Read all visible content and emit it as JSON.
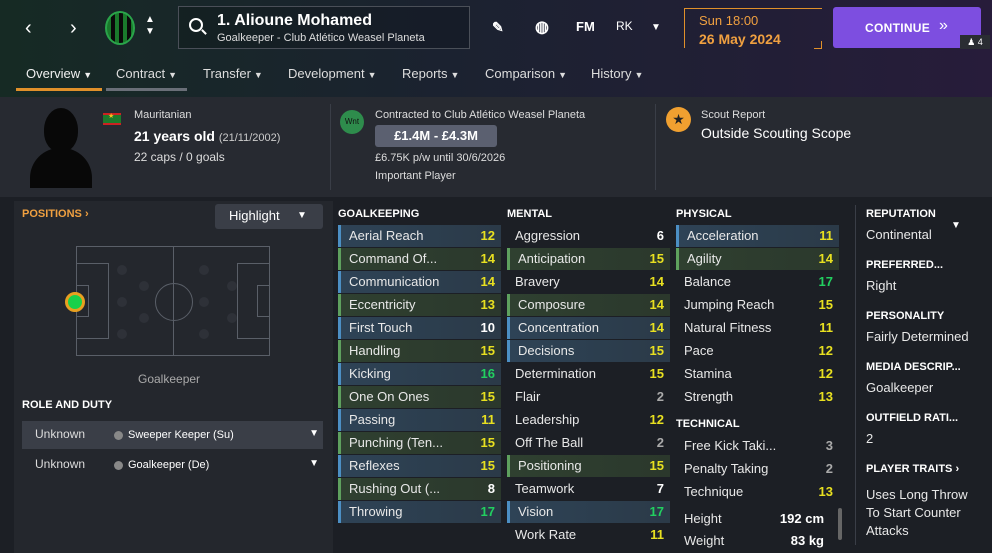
{
  "header": {
    "player_name": "1. Alioune Mohamed",
    "player_sub": "Goalkeeper - Club Atlético Weasel Planeta",
    "fm_label": "FM",
    "initials": "RK",
    "day_time": "Sun 18:00",
    "date": "26 May 2024",
    "continue_label": "CONTINUE",
    "manager_count": "4"
  },
  "tabs": [
    {
      "label": "Overview"
    },
    {
      "label": "Contract"
    },
    {
      "label": "Transfer"
    },
    {
      "label": "Development"
    },
    {
      "label": "Reports"
    },
    {
      "label": "Comparison"
    },
    {
      "label": "History"
    }
  ],
  "info": {
    "nationality": "Mauritanian",
    "age": "21 years old",
    "dob": "(21/11/2002)",
    "caps": "22 caps / 0 goals",
    "wnt": "Wnt",
    "contracted": "Contracted to Club Atlético Weasel Planeta",
    "value": "£1.4M - £4.3M",
    "wage": "£6.75K p/w until 30/6/2026",
    "squad_status": "Important Player",
    "scout_title": "Scout Report",
    "scout_value": "Outside Scouting Scope"
  },
  "positions": {
    "link": "POSITIONS",
    "highlight": "Highlight",
    "label": "Goalkeeper"
  },
  "role_duty": {
    "title": "ROLE AND DUTY",
    "rows": [
      {
        "role": "Unknown",
        "duty": "Sweeper Keeper (Su)"
      },
      {
        "role": "Unknown",
        "duty": "Goalkeeper (De)"
      }
    ]
  },
  "goalkeeping": {
    "title": "GOALKEEPING",
    "attrs": [
      {
        "name": "Aerial Reach",
        "value": "12"
      },
      {
        "name": "Command Of...",
        "value": "14"
      },
      {
        "name": "Communication",
        "value": "14"
      },
      {
        "name": "Eccentricity",
        "value": "13"
      },
      {
        "name": "First Touch",
        "value": "10"
      },
      {
        "name": "Handling",
        "value": "15"
      },
      {
        "name": "Kicking",
        "value": "16"
      },
      {
        "name": "One On Ones",
        "value": "15"
      },
      {
        "name": "Passing",
        "value": "11"
      },
      {
        "name": "Punching (Ten...",
        "value": "15"
      },
      {
        "name": "Reflexes",
        "value": "15"
      },
      {
        "name": "Rushing Out (...",
        "value": "8"
      },
      {
        "name": "Throwing",
        "value": "17"
      }
    ]
  },
  "mental": {
    "title": "MENTAL",
    "attrs": [
      {
        "name": "Aggression",
        "value": "6"
      },
      {
        "name": "Anticipation",
        "value": "15"
      },
      {
        "name": "Bravery",
        "value": "14"
      },
      {
        "name": "Composure",
        "value": "14"
      },
      {
        "name": "Concentration",
        "value": "14"
      },
      {
        "name": "Decisions",
        "value": "15"
      },
      {
        "name": "Determination",
        "value": "15"
      },
      {
        "name": "Flair",
        "value": "2"
      },
      {
        "name": "Leadership",
        "value": "12"
      },
      {
        "name": "Off The Ball",
        "value": "2"
      },
      {
        "name": "Positioning",
        "value": "15"
      },
      {
        "name": "Teamwork",
        "value": "7"
      },
      {
        "name": "Vision",
        "value": "17"
      },
      {
        "name": "Work Rate",
        "value": "11"
      }
    ]
  },
  "physical": {
    "title": "PHYSICAL",
    "attrs": [
      {
        "name": "Acceleration",
        "value": "11"
      },
      {
        "name": "Agility",
        "value": "14"
      },
      {
        "name": "Balance",
        "value": "17"
      },
      {
        "name": "Jumping Reach",
        "value": "15"
      },
      {
        "name": "Natural Fitness",
        "value": "11"
      },
      {
        "name": "Pace",
        "value": "12"
      },
      {
        "name": "Stamina",
        "value": "12"
      },
      {
        "name": "Strength",
        "value": "13"
      }
    ]
  },
  "technical": {
    "title": "TECHNICAL",
    "attrs": [
      {
        "name": "Free Kick Taki...",
        "value": "3"
      },
      {
        "name": "Penalty Taking",
        "value": "2"
      },
      {
        "name": "Technique",
        "value": "13"
      }
    ]
  },
  "body": {
    "height_label": "Height",
    "height": "192 cm",
    "weight_label": "Weight",
    "weight": "83 kg"
  },
  "right_panel": {
    "reputation_title": "REPUTATION",
    "reputation": "Continental",
    "preferred_title": "PREFERRED...",
    "preferred": "Right",
    "personality_title": "PERSONALITY",
    "personality": "Fairly Determined",
    "media_title": "MEDIA DESCRIP...",
    "media": "Goalkeeper",
    "outfield_title": "OUTFIELD RATI...",
    "outfield": "2",
    "traits_title": "PLAYER TRAITS",
    "traits": "Uses Long Throw To Start Counter Attacks"
  },
  "colors": {
    "accent_orange": "#e0902a",
    "continue_purple": "#7d4ee0",
    "attr_green": "#22d060",
    "attr_yellow": "#e8e020"
  }
}
